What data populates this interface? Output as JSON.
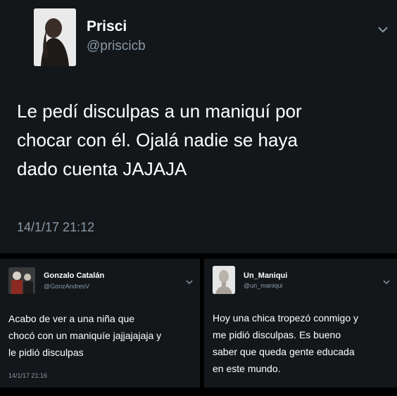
{
  "main_tweet": {
    "name": "Prisci",
    "handle": "@priscicb",
    "text_lines": [
      "Le pedí disculpas a un maniquí por",
      "chocar con él. Ojalá nadie se haya",
      "dado cuenta JAJAJA"
    ],
    "timestamp": "14/1/17 21:12",
    "menu_icon": "chevron-down-icon"
  },
  "reply_left": {
    "name": "Gonzalo Catalán",
    "handle": "@GonzAndresV",
    "text_lines": [
      "Acabo de ver a una niña que",
      "chocó con un maniquíe jajjajajaja y",
      "le pidió disculpas"
    ],
    "timestamp": "14/1/17 21:16",
    "menu_icon": "chevron-down-icon"
  },
  "reply_right": {
    "name": "Un_Maniqui",
    "handle": "@un_maniqui",
    "text_lines": [
      "Hoy una chica tropezó conmigo y",
      "me pidió disculpas. Es bueno",
      "saber que queda gente educada",
      "en este mundo."
    ],
    "menu_icon": "chevron-down-icon"
  },
  "colors": {
    "card_background": "#14171a",
    "page_background": "#000000",
    "secondary_text": "#8899a6",
    "primary_text": "#ffffff"
  }
}
